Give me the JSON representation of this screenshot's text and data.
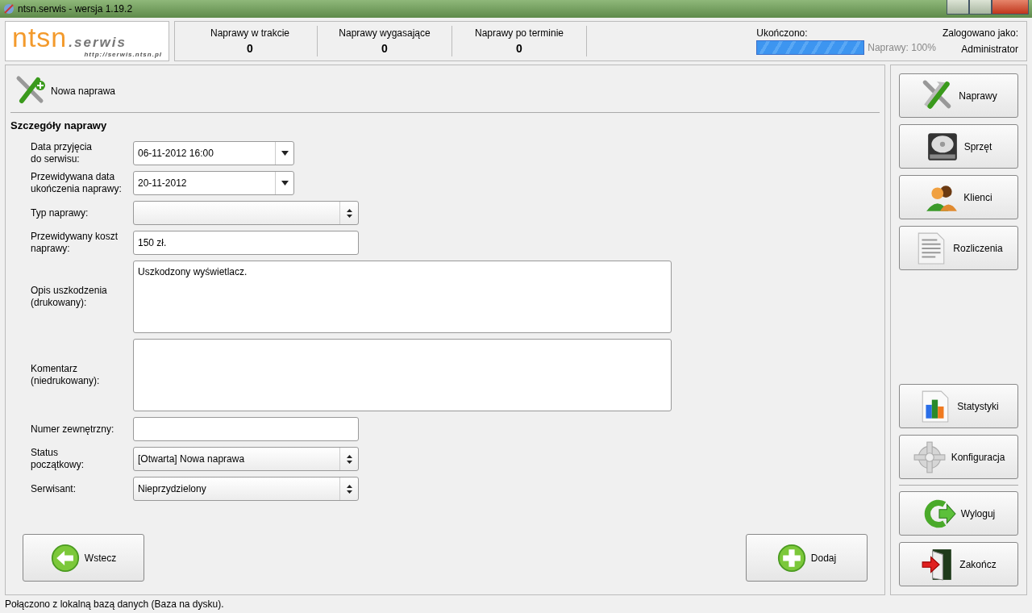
{
  "window": {
    "title": "ntsn.serwis - wersja 1.19.2"
  },
  "header": {
    "logo": {
      "name": "ntsn",
      "suffix": ".serwis",
      "url": "http://serwis.ntsn.pl"
    },
    "counters": [
      {
        "label": "Naprawy w trakcie",
        "value": "0"
      },
      {
        "label": "Naprawy wygasające",
        "value": "0"
      },
      {
        "label": "Naprawy po terminie",
        "value": "0"
      }
    ],
    "progress": {
      "label": "Ukończono:",
      "level": 1,
      "reading": "Naprawy: 100%"
    },
    "user": {
      "label": "Zalogowano jako:",
      "name": "Administrator"
    }
  },
  "page": {
    "title": "Nowa naprawa",
    "section": "Szczegóły naprawy",
    "fields": [
      {
        "kind": "date",
        "label": "Data przyjęcia\ndo serwisu:",
        "value": "06-11-2012 16:00"
      },
      {
        "kind": "date",
        "label": "Przewidywana data\nukończenia naprawy:",
        "value": "20-11-2012"
      },
      {
        "kind": "select",
        "label": "Typ naprawy:"
      },
      {
        "kind": "text",
        "label": "Przewidywany koszt\nnaprawy:",
        "value": "150 zł."
      },
      {
        "kind": "textarea",
        "label": "Opis uszkodzenia\n(drukowany):",
        "value": "Uszkodzony wyświetlacz."
      },
      {
        "kind": "textarea",
        "label": "Komentarz\n(niedrukowany):"
      },
      {
        "kind": "text",
        "label": "Numer zewnętrzny:"
      },
      {
        "kind": "select",
        "label": "Status\npoczątkowy:",
        "value": "[Otwarta] Nowa naprawa"
      },
      {
        "kind": "select",
        "label": "Serwisant:",
        "value": "Nieprzydzielony"
      }
    ],
    "back_button": "Wstecz",
    "add_button": "Dodaj"
  },
  "sidebar": {
    "sections": [
      {
        "items": [
          "Naprawy",
          "Sprzęt",
          "Klienci",
          "Rozliczenia"
        ]
      },
      {
        "items": [
          "Statystyki",
          "Konfiguracja"
        ]
      },
      {
        "items": [
          "Wyloguj",
          "Zakończ"
        ]
      }
    ]
  },
  "status_bar": "Połączono z lokalną bazą danych (Baza na dysku)."
}
